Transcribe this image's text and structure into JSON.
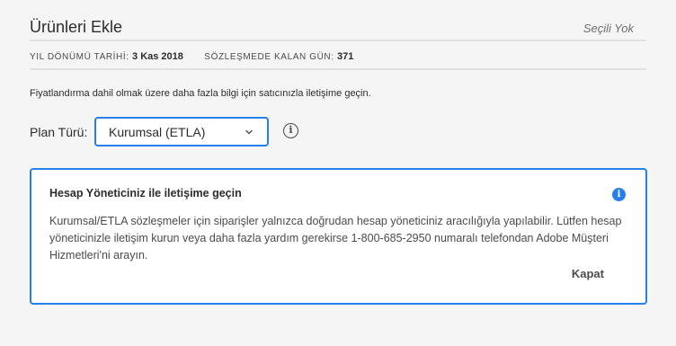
{
  "header": {
    "title": "Ürünleri Ekle",
    "selection_status": "Seçili Yok"
  },
  "meta": {
    "anniversary_label": "YIL DÖNÜMÜ TARİHİ:",
    "anniversary_value": "3 Kas 2018",
    "remaining_label": "SÖZLEŞMEDE KALAN GÜN:",
    "remaining_value": "371"
  },
  "info_text": "Fiyatlandırma dahil olmak üzere daha fazla bilgi için satıcınızla iletişime geçin.",
  "plan": {
    "label": "Plan Türü:",
    "selected": "Kurumsal (ETLA)",
    "info_icon_glyph": "i"
  },
  "alert": {
    "title": "Hesap Yöneticiniz ile iletişime geçin",
    "icon_glyph": "i",
    "body": "Kurumsal/ETLA sözleşmeler için siparişler yalnızca doğrudan hesap yöneticiniz aracılığıyla yapılabilir. Lütfen hesap yöneticinizle iletişim kurun veya daha fazla yardım gerekirse 1-800-685-2950 numaralı telefondan Adobe Müşteri Hizmetleri'ni arayın.",
    "close_label": "Kapat"
  },
  "colors": {
    "accent": "#2680eb",
    "background": "#f5f5f5",
    "text": "#2c2c2c",
    "muted": "#6e6e6e"
  },
  "icons": {
    "chevron": "chevron-down-icon",
    "plan_info": "info-outline-icon",
    "alert_info": "info-filled-icon"
  }
}
